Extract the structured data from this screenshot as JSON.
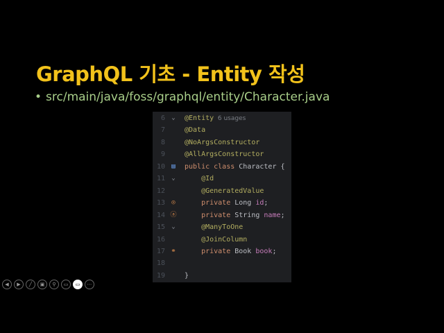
{
  "slide": {
    "title": "GraphQL 기초 - Entity 작성",
    "bullet": "src/main/java/foss/graphql/entity/Character.java",
    "bullet_marker": "•"
  },
  "code": {
    "lines": [
      {
        "n": "6",
        "gutter": "⌄",
        "tokens": [
          [
            "@Entity",
            "ann"
          ],
          [
            "  6 usages",
            "hint"
          ]
        ]
      },
      {
        "n": "7",
        "gutter": "",
        "tokens": [
          [
            "@Data",
            "ann"
          ]
        ]
      },
      {
        "n": "8",
        "gutter": "",
        "tokens": [
          [
            "@NoArgsConstructor",
            "ann"
          ]
        ]
      },
      {
        "n": "9",
        "gutter": "",
        "tokens": [
          [
            "@AllArgsConstructor",
            "ann"
          ]
        ]
      },
      {
        "n": "10",
        "gutter": "▤",
        "tokens": [
          [
            "public class ",
            "kw"
          ],
          [
            "Character {",
            "id"
          ]
        ]
      },
      {
        "n": "11",
        "gutter": "⌄",
        "tokens": [
          [
            "    @Id",
            "ann"
          ]
        ]
      },
      {
        "n": "12",
        "gutter": "",
        "tokens": [
          [
            "    @GeneratedValue",
            "ann"
          ]
        ]
      },
      {
        "n": "13",
        "gutter": "◎",
        "tokens": [
          [
            "    private ",
            "kw"
          ],
          [
            "Long ",
            "id"
          ],
          [
            "id",
            "fld"
          ],
          [
            ";",
            "id"
          ]
        ]
      },
      {
        "n": "14",
        "gutter": "ⓐ",
        "tokens": [
          [
            "    private ",
            "kw"
          ],
          [
            "String ",
            "id"
          ],
          [
            "name",
            "fld"
          ],
          [
            ";",
            "id"
          ]
        ]
      },
      {
        "n": "15",
        "gutter": "⌄",
        "tokens": [
          [
            "    @ManyToOne",
            "ann"
          ]
        ]
      },
      {
        "n": "16",
        "gutter": "",
        "tokens": [
          [
            "    @JoinColumn",
            "ann"
          ]
        ]
      },
      {
        "n": "17",
        "gutter": "⚭",
        "tokens": [
          [
            "    private ",
            "kw"
          ],
          [
            "Book ",
            "id"
          ],
          [
            "book",
            "fld"
          ],
          [
            ";",
            "id"
          ]
        ]
      },
      {
        "n": "18",
        "gutter": "",
        "tokens": []
      },
      {
        "n": "19",
        "gutter": "",
        "tokens": [
          [
            "}",
            "id"
          ]
        ]
      }
    ]
  },
  "controls": [
    {
      "name": "previous-slide-button",
      "glyph": "◀"
    },
    {
      "name": "next-slide-button",
      "glyph": "▶"
    },
    {
      "name": "pen-button",
      "glyph": "╱"
    },
    {
      "name": "all-slides-button",
      "glyph": "▣"
    },
    {
      "name": "zoom-button",
      "glyph": "⚲"
    },
    {
      "name": "subtitles-button",
      "glyph": "▭"
    },
    {
      "name": "camera-button",
      "glyph": "▭",
      "active": true
    },
    {
      "name": "more-options-button",
      "glyph": "⋯"
    }
  ]
}
